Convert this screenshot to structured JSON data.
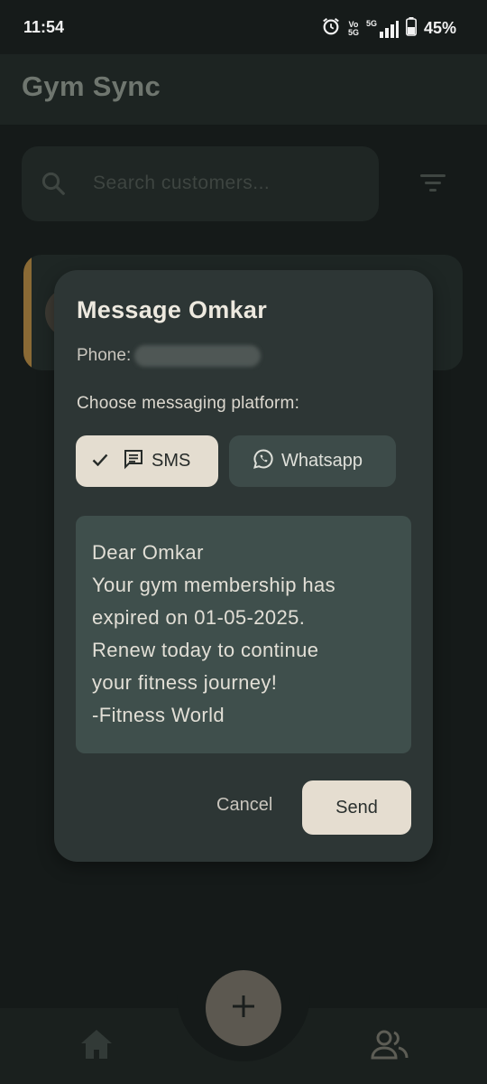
{
  "status_bar": {
    "time": "11:54",
    "battery_percent": "45%",
    "network_top": "Vo",
    "network_bottom": "5G",
    "signal_label": "5G",
    "icons": [
      "alarm-icon",
      "volte-icon",
      "signal-icon",
      "battery-icon"
    ]
  },
  "app_bar": {
    "title": "Gym Sync"
  },
  "search": {
    "placeholder": "Search customers..."
  },
  "dialog": {
    "title": "Message Omkar",
    "phone_label": "Phone:",
    "platform_label": "Choose messaging platform:",
    "platforms": [
      {
        "label": "SMS",
        "selected": true,
        "icon": "sms-icon"
      },
      {
        "label": "Whatsapp",
        "selected": false,
        "icon": "whatsapp-icon"
      }
    ],
    "message_lines": [
      "Dear Omkar",
      "Your gym membership has",
      "expired on 01-05-2025.",
      "Renew today to continue",
      "your fitness journey!",
      "-Fitness World"
    ],
    "cancel_label": "Cancel",
    "send_label": "Send"
  },
  "bottom_nav": {
    "items": [
      {
        "icon": "home-icon"
      },
      {
        "icon": "people-icon"
      }
    ],
    "fab_icon": "plus-icon"
  },
  "colors": {
    "background": "#151a19",
    "dialog": "#2d3635",
    "message_box": "#3f4f4c",
    "accent_chip": "#e4ddd0",
    "card_accent": "#8a6a35"
  }
}
